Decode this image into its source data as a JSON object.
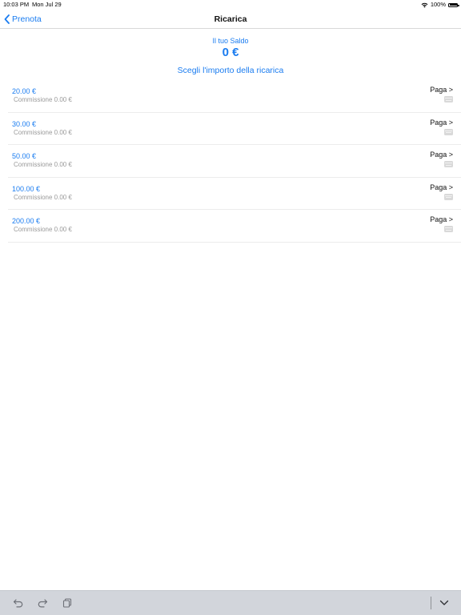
{
  "status_bar": {
    "time": "10:03 PM",
    "date": "Mon Jul 29",
    "battery": "100%",
    "wifi_icon": "wifi-icon",
    "battery_icon": "battery-icon"
  },
  "navbar": {
    "back_label": "Prenota",
    "back_icon": "chevron-left-icon",
    "title": "Ricarica"
  },
  "balance": {
    "label": "Il tuo Saldo",
    "value": "0 €"
  },
  "choose_label": "Scegli l'importo della ricarica",
  "options": [
    {
      "amount": "20.00 €",
      "fee": "Commissione 0.00 €",
      "pay_label": "Paga >",
      "icon": "credit-card-icon"
    },
    {
      "amount": "30.00 €",
      "fee": "Commissione 0.00 €",
      "pay_label": "Paga >",
      "icon": "credit-card-icon"
    },
    {
      "amount": "50.00 €",
      "fee": "Commissione 0.00 €",
      "pay_label": "Paga >",
      "icon": "credit-card-icon"
    },
    {
      "amount": "100.00 €",
      "fee": "Commissione 0.00 €",
      "pay_label": "Paga >",
      "icon": "credit-card-icon"
    },
    {
      "amount": "200.00 €",
      "fee": "Commissione 0.00 €",
      "pay_label": "Paga >",
      "icon": "credit-card-icon"
    }
  ],
  "keyboard_bar": {
    "icons": [
      "undo-icon",
      "redo-icon",
      "clipboard-icon",
      "keyboard-dismiss-icon"
    ]
  },
  "colors": {
    "accent": "#1a7cf0",
    "muted_text": "#9a9a9a",
    "toolbar_bg": "#d2d5db"
  }
}
